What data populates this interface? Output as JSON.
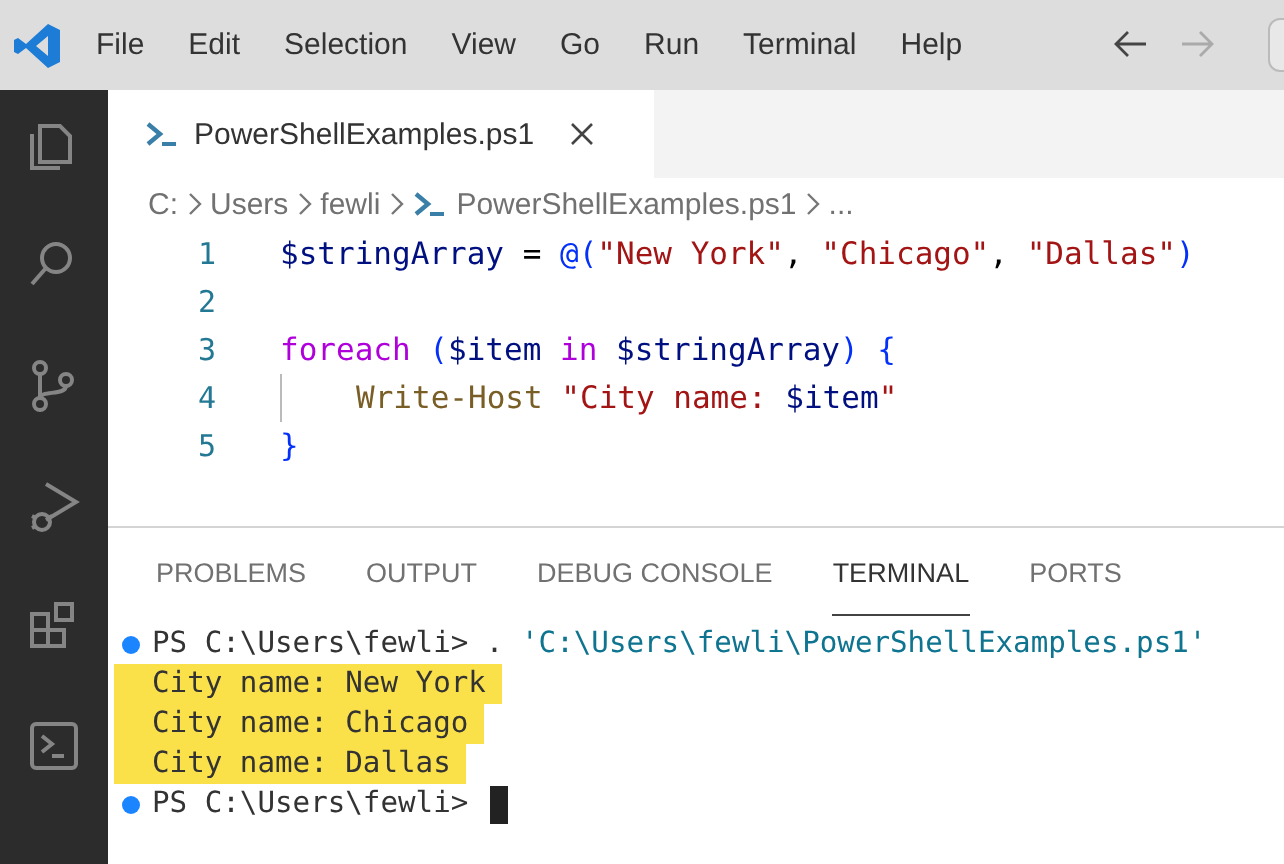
{
  "menu": [
    "File",
    "Edit",
    "Selection",
    "View",
    "Go",
    "Run",
    "Terminal",
    "Help"
  ],
  "activity_bar": [
    {
      "kind": "explorer",
      "selected": false
    },
    {
      "kind": "search",
      "selected": false
    },
    {
      "kind": "source_control",
      "selected": false
    },
    {
      "kind": "run_debug",
      "selected": false
    },
    {
      "kind": "extensions",
      "selected": false
    },
    {
      "kind": "terminal",
      "selected": false
    }
  ],
  "editor_tabs": [
    {
      "label": "PowerShellExamples.ps1",
      "selected": true
    }
  ],
  "breadcrumb": [
    {
      "label": "C:",
      "kind": "folder"
    },
    {
      "label": "Users",
      "kind": "folder"
    },
    {
      "label": "fewli",
      "kind": "folder"
    },
    {
      "label": "PowerShellExamples.ps1",
      "kind": "file"
    },
    {
      "label": "...",
      "kind": "more"
    }
  ],
  "code": [
    {
      "number": "1",
      "guide": false,
      "tokens": [
        {
          "text": "$stringArray",
          "kind": "variable"
        },
        {
          "text": " = ",
          "kind": "plain"
        },
        {
          "text": "@(",
          "kind": "bracket"
        },
        {
          "text": "\"New York\"",
          "kind": "string"
        },
        {
          "text": ", ",
          "kind": "plain"
        },
        {
          "text": "\"Chicago\"",
          "kind": "string"
        },
        {
          "text": ", ",
          "kind": "plain"
        },
        {
          "text": "\"Dallas\"",
          "kind": "string"
        },
        {
          "text": ")",
          "kind": "bracket"
        }
      ]
    },
    {
      "number": "2",
      "guide": false
    },
    {
      "number": "3",
      "guide": false,
      "tokens": [
        {
          "text": "foreach ",
          "kind": "keyword"
        },
        {
          "text": "(",
          "kind": "bracket"
        },
        {
          "text": "$item ",
          "kind": "variable"
        },
        {
          "text": "in ",
          "kind": "keyword"
        },
        {
          "text": "$stringArray",
          "kind": "variable"
        },
        {
          "text": ") {",
          "kind": "bracket"
        }
      ]
    },
    {
      "number": "4",
      "guide": true,
      "tokens": [
        {
          "text": "Write-Host ",
          "kind": "command"
        },
        {
          "text": "\"City name: ",
          "kind": "string"
        },
        {
          "text": "$item",
          "kind": "variable"
        },
        {
          "text": "\"",
          "kind": "string"
        }
      ]
    },
    {
      "number": "5",
      "guide": false,
      "tokens": [
        {
          "text": "}",
          "kind": "bracket"
        }
      ]
    }
  ],
  "panel_tabs": [
    {
      "label": "PROBLEMS",
      "selected": false
    },
    {
      "label": "OUTPUT",
      "selected": false
    },
    {
      "label": "DEBUG CONSOLE",
      "selected": false
    },
    {
      "label": "TERMINAL",
      "selected": true
    },
    {
      "label": "PORTS",
      "selected": false
    }
  ],
  "terminal": [
    {
      "kind": "prompt",
      "highlighted": false,
      "cursor": false,
      "tokens": [
        {
          "text": "PS C:\\Users\\fewli> . ",
          "kind": "plain"
        },
        {
          "text": "'C:\\Users\\fewli\\PowerShellExamples.ps1'",
          "kind": "path"
        }
      ]
    },
    {
      "kind": "output",
      "highlighted": true,
      "cursor": false,
      "tokens": [
        {
          "text": "City name: New York",
          "kind": "plain"
        }
      ]
    },
    {
      "kind": "output",
      "highlighted": true,
      "cursor": false,
      "tokens": [
        {
          "text": "City name: Chicago",
          "kind": "plain"
        }
      ]
    },
    {
      "kind": "output",
      "highlighted": true,
      "cursor": false,
      "tokens": [
        {
          "text": "City name: Dallas",
          "kind": "plain"
        }
      ]
    },
    {
      "kind": "prompt",
      "highlighted": false,
      "cursor": true,
      "tokens": [
        {
          "text": "PS C:\\Users\\fewli> ",
          "kind": "plain"
        }
      ]
    }
  ]
}
